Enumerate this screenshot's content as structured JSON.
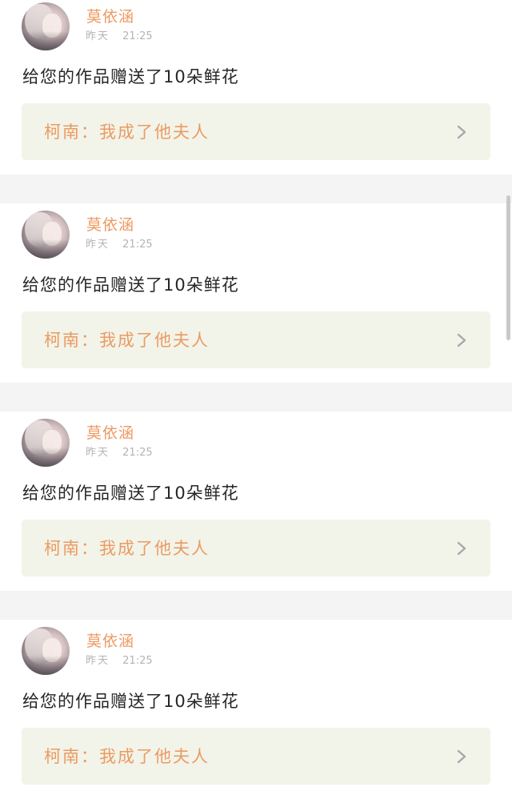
{
  "feed": {
    "items": [
      {
        "username": "莫依涵",
        "time_day": "昨天",
        "time_clock": "21:25",
        "message": "给您的作品赠送了10朵鲜花",
        "work_title": "柯南：我成了他夫人"
      },
      {
        "username": "莫依涵",
        "time_day": "昨天",
        "time_clock": "21:25",
        "message": "给您的作品赠送了10朵鲜花",
        "work_title": "柯南：我成了他夫人"
      },
      {
        "username": "莫依涵",
        "time_day": "昨天",
        "time_clock": "21:25",
        "message": "给您的作品赠送了10朵鲜花",
        "work_title": "柯南：我成了他夫人"
      },
      {
        "username": "莫依涵",
        "time_day": "昨天",
        "time_clock": "21:25",
        "message": "给您的作品赠送了10朵鲜花",
        "work_title": "柯南：我成了他夫人"
      }
    ]
  },
  "icons": {
    "avatar": "user-avatar-image",
    "chevron": "chevron-right-icon"
  },
  "colors": {
    "page_background": "#f4f4f4",
    "card_background": "#ffffff",
    "accent_orange": "#ec9a62",
    "link_background": "#f2f4e9",
    "muted_text": "#b4b4b4",
    "body_text": "#262626",
    "chevron": "#a8a8a8"
  }
}
